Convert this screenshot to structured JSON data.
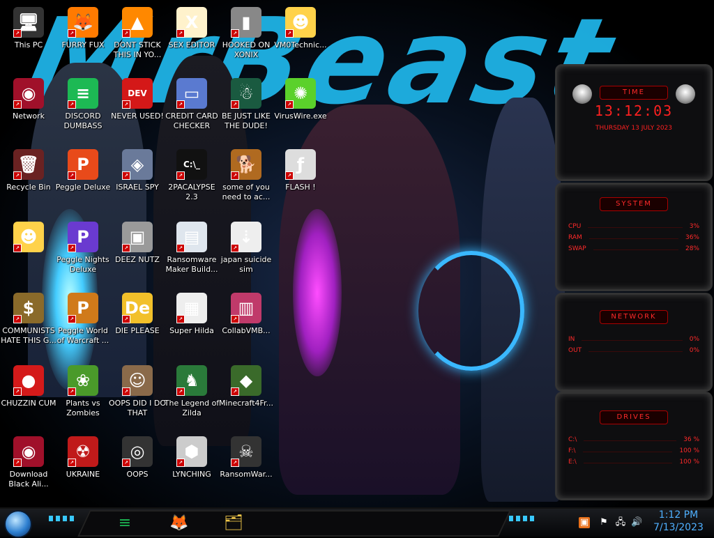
{
  "wallpaper": {
    "title_text": "MrBeast"
  },
  "desktop_icons": [
    {
      "label": "This PC",
      "icon": "pc-icon",
      "glyph": "🖥",
      "color": "#333"
    },
    {
      "label": "FURRY FUX",
      "icon": "firefox-icon",
      "glyph": "🦊",
      "color": "#ff7a00"
    },
    {
      "label": "DONT STICK THIS IN YO...",
      "icon": "vlc-icon",
      "glyph": "▲",
      "color": "#ff8800"
    },
    {
      "label": "SEX EDITOR",
      "icon": "hxd-icon",
      "glyph": "X",
      "color": "#fff2cc"
    },
    {
      "label": "HOOKED ON XONIX",
      "icon": "xonix-icon",
      "glyph": "▮",
      "color": "#888"
    },
    {
      "label": "VM0Technic...",
      "icon": "star-butterfly-icon",
      "glyph": "☻",
      "color": "#ffd24a"
    },
    {
      "label": "Network",
      "icon": "network-icon",
      "glyph": "◉",
      "color": "#a0102a"
    },
    {
      "label": "DISCORD DUMBASS",
      "icon": "spotify-icon",
      "glyph": "≡",
      "color": "#1db954"
    },
    {
      "label": "NEVER USED!",
      "icon": "devcpp-icon",
      "glyph": "DEV",
      "color": "#d41818"
    },
    {
      "label": "CREDIT CARD CHECKER",
      "icon": "credit-card-icon",
      "glyph": "▭",
      "color": "#5a7ad0"
    },
    {
      "label": "BE JUST LIKE THE DUDE!",
      "icon": "santa-icon",
      "glyph": "☃",
      "color": "#1a5a40"
    },
    {
      "label": "VirusWire.exe",
      "icon": "lime-icon",
      "glyph": "✺",
      "color": "#5bd12b"
    },
    {
      "label": "Recycle Bin",
      "icon": "recycle-bin-icon",
      "glyph": "🗑",
      "color": "#6a2222"
    },
    {
      "label": "Peggle Deluxe",
      "icon": "peggle-icon",
      "glyph": "P",
      "color": "#e84a1a"
    },
    {
      "label": "ISRAEL SPY",
      "icon": "spy-icon",
      "glyph": "◈",
      "color": "#6a7a9a"
    },
    {
      "label": "2PACALYPSE 2.3",
      "icon": "terminal-icon",
      "glyph": "C:\\_",
      "color": "#111"
    },
    {
      "label": "some of you need to ac...",
      "icon": "dog-icon",
      "glyph": "🐕",
      "color": "#b06a20"
    },
    {
      "label": "FLASH !",
      "icon": "flash-icon",
      "glyph": "ƒ",
      "color": "#ddd"
    },
    {
      "label": "",
      "icon": "star-butterfly-icon",
      "glyph": "☻",
      "color": "#ffd24a"
    },
    {
      "label": "Peggle Nights Deluxe",
      "icon": "peggle-nights-icon",
      "glyph": "P",
      "color": "#6a3ad0"
    },
    {
      "label": "DEEZ NUTZ",
      "icon": "windows-stack-icon",
      "glyph": "▣",
      "color": "#9a9a9a"
    },
    {
      "label": "Ransomware Maker Build...",
      "icon": "window-app-icon",
      "glyph": "▤",
      "color": "#dfe6ee"
    },
    {
      "label": "japan suicide sim",
      "icon": "japan-icon",
      "glyph": "⇣",
      "color": "#eee"
    },
    {
      "label": "COMMUNISTS HATE THIS G...",
      "icon": "money-bag-icon",
      "glyph": "$",
      "color": "#8a6a2a"
    },
    {
      "label": "Peggle World of Warcraft ...",
      "icon": "peggle-wow-icon",
      "glyph": "P",
      "color": "#d07a1a"
    },
    {
      "label": "DIE PLEASE",
      "icon": "deluge-icon",
      "glyph": "De",
      "color": "#f2c02a"
    },
    {
      "label": "Super Hilda",
      "icon": "pixel-icon",
      "glyph": "▦",
      "color": "#eee"
    },
    {
      "label": "CollabVMB...",
      "icon": "collabvm-icon",
      "glyph": "▥",
      "color": "#c03a6a"
    },
    {
      "label": "CHUZZIN CUM",
      "icon": "chuzzle-icon",
      "glyph": "●",
      "color": "#d41a1a"
    },
    {
      "label": "Plants vs Zombies",
      "icon": "pvz-icon",
      "glyph": "❀",
      "color": "#4a9a2a"
    },
    {
      "label": "OOPS DID I DO THAT",
      "icon": "portrait-icon",
      "glyph": "☺",
      "color": "#8a6a4a"
    },
    {
      "label": "The Legend of Zilda",
      "icon": "zelda-icon",
      "glyph": "♞",
      "color": "#2a7a3a"
    },
    {
      "label": "Minecraft4Fr...",
      "icon": "minecraft-icon",
      "glyph": "◆",
      "color": "#3a6a2a"
    },
    {
      "label": "Download Black Ali...",
      "icon": "alien-orb-icon",
      "glyph": "◉",
      "color": "#a0102a"
    },
    {
      "label": "UKRAINE",
      "icon": "radiation-icon",
      "glyph": "☢",
      "color": "#c01a1a"
    },
    {
      "label": "OOPS",
      "icon": "cd-case-icon",
      "glyph": "◎",
      "color": "#333"
    },
    {
      "label": "LYNCHING",
      "icon": "network-globe-icon",
      "glyph": "⬢",
      "color": "#ccc"
    },
    {
      "label": "RansomWar...",
      "icon": "skull-icon",
      "glyph": "☠",
      "color": "#333"
    }
  ],
  "gadgets": {
    "time": {
      "title": "TIME",
      "clock": "13:12:03",
      "date": "THURSDAY 13 JULY 2023"
    },
    "system": {
      "title": "SYSTEM",
      "rows": [
        {
          "label": "CPU",
          "value": "3%"
        },
        {
          "label": "RAM",
          "value": "36%"
        },
        {
          "label": "SWAP",
          "value": "28%"
        }
      ]
    },
    "network": {
      "title": "NETWORK",
      "rows": [
        {
          "label": "IN",
          "value": "0%"
        },
        {
          "label": "OUT",
          "value": "0%"
        }
      ]
    },
    "drives": {
      "title": "DRIVES",
      "rows": [
        {
          "label": "C:\\",
          "value": "36 %"
        },
        {
          "label": "F:\\",
          "value": "100 %"
        },
        {
          "label": "E:\\",
          "value": "100 %"
        }
      ]
    }
  },
  "taskbar": {
    "pinned": [
      {
        "name": "spotify-icon",
        "glyph": "≡",
        "color": "#1db954"
      },
      {
        "name": "firefox-icon",
        "glyph": "🦊",
        "color": "#ff7a00"
      },
      {
        "name": "file-explorer-icon",
        "glyph": "🗂",
        "color": "#f2c84a"
      }
    ],
    "clock_time": "1:12 PM",
    "clock_date": "7/13/2023"
  },
  "colors": {
    "accent_red": "#ff2a2a",
    "accent_cyan": "#38c8ff",
    "clock_blue": "#4fb0ff"
  }
}
